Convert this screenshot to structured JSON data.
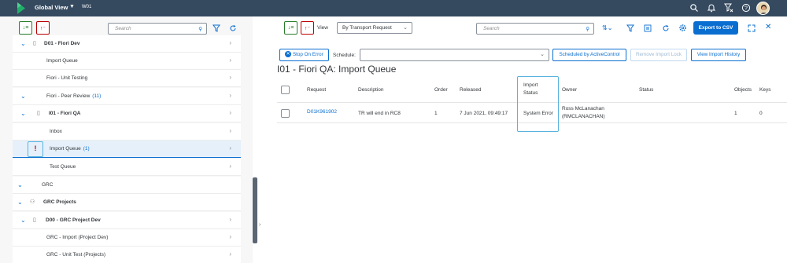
{
  "shell": {
    "title": "Global View",
    "system": "W01",
    "colors": {
      "bar": "#354a5f",
      "accent": "#0a6ed1"
    }
  },
  "left": {
    "search_placeholder": "Search",
    "tree": [
      {
        "label": "D01 - Fiori Dev",
        "bold": true,
        "expanded": true,
        "icon": "box-icon"
      },
      {
        "label": "Import Queue"
      },
      {
        "label": "Fiori - Unit Testing"
      },
      {
        "label": "Fiori - Peer Review",
        "count": "(11)",
        "expanded": true
      },
      {
        "label": "I01 - Fiori QA",
        "bold": true,
        "expanded": true,
        "icon": "box-icon"
      },
      {
        "label": "Inbox"
      },
      {
        "label": "Import Queue",
        "count": "(1)",
        "selected": true,
        "warning": "!"
      },
      {
        "label": "Test Queue"
      },
      {
        "label": "GRC",
        "expanded": true
      },
      {
        "label": "GRC Projects",
        "bold": true,
        "expanded": true,
        "icon": "people-icon"
      },
      {
        "label": "D00 - GRC Project Dev",
        "bold": true,
        "expanded": true,
        "icon": "box-icon"
      },
      {
        "label": "GRC - Import (Project Dev)"
      },
      {
        "label": "GRC - Unit Test (Projects)"
      }
    ]
  },
  "right": {
    "view_label": "View",
    "view_value": "By Transport Request",
    "search_placeholder": "Search",
    "export_label": "Export to CSV",
    "actions": {
      "stop_on_error": "Stop On Error",
      "schedule_label": "Schedule:",
      "scheduled_by_activecontrol": "Scheduled by ActiveControl",
      "remove_import_lock": "Remove Import Lock",
      "view_import_history": "View Import History"
    },
    "page_title": "I01 - Fiori QA: Import Queue",
    "columns": {
      "request": "Request",
      "description": "Description",
      "order": "Order",
      "released": "Released",
      "import_status_1": "Import",
      "import_status_2": "Status",
      "owner": "Owner",
      "status": "Status",
      "objects": "Objects",
      "keys": "Keys"
    },
    "rows": [
      {
        "request": "D01K961902",
        "description": "TR will end in RC8",
        "order": "1",
        "released": "7 Jun 2021, 09:49:17",
        "import_status": "System Error",
        "owner_name": "Ross McLanachan",
        "owner_id": "(RMCLANACHAN)",
        "status": "",
        "objects": "1",
        "keys": "0"
      }
    ]
  }
}
